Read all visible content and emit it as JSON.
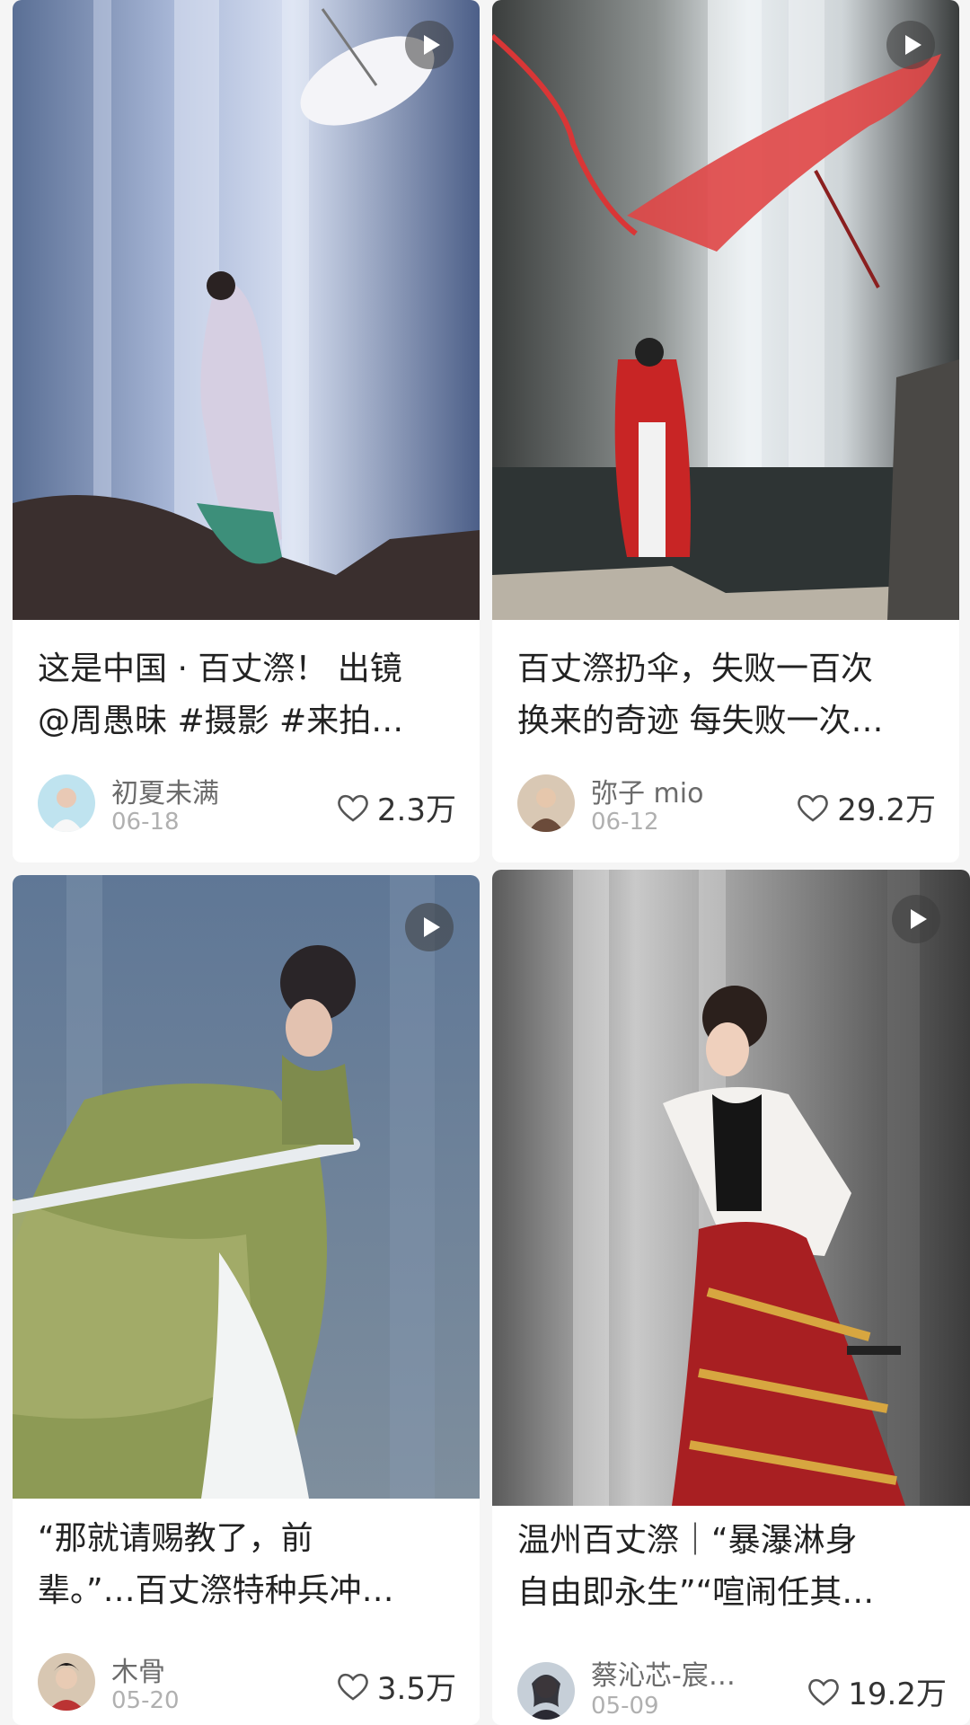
{
  "cards": [
    {
      "title_line1": "这是中国 · 百丈漈！ 出镜",
      "title_line2": "@周愚昧 #摄影 #来拍…",
      "author": "初夏未满",
      "date": "06-18",
      "likes": "2.3万",
      "icon": "video-play-icon"
    },
    {
      "title_line1": "百丈漈扔伞，失败一百次",
      "title_line2": "换来的奇迹 每失败一次…",
      "author": "弥子 mio",
      "date": "06-12",
      "likes": "29.2万",
      "icon": "video-play-icon"
    },
    {
      "title_line1": "“那就请赐教了，前",
      "title_line2": "辈。”…百丈漈特种兵冲…",
      "author": "木骨",
      "date": "05-20",
      "likes": "3.5万",
      "icon": "video-play-icon"
    },
    {
      "title_line1": "温州百丈漈｜“暴瀑淋身",
      "title_line2": "自由即永生”“喧闹任其…",
      "author": "蔡沁芯-宸…",
      "date": "05-09",
      "likes": "19.2万",
      "icon": "video-play-icon"
    }
  ],
  "colors": {
    "background": "#f5f5f5",
    "card": "#ffffff",
    "title": "#222222",
    "meta": "#b0b0b0"
  }
}
